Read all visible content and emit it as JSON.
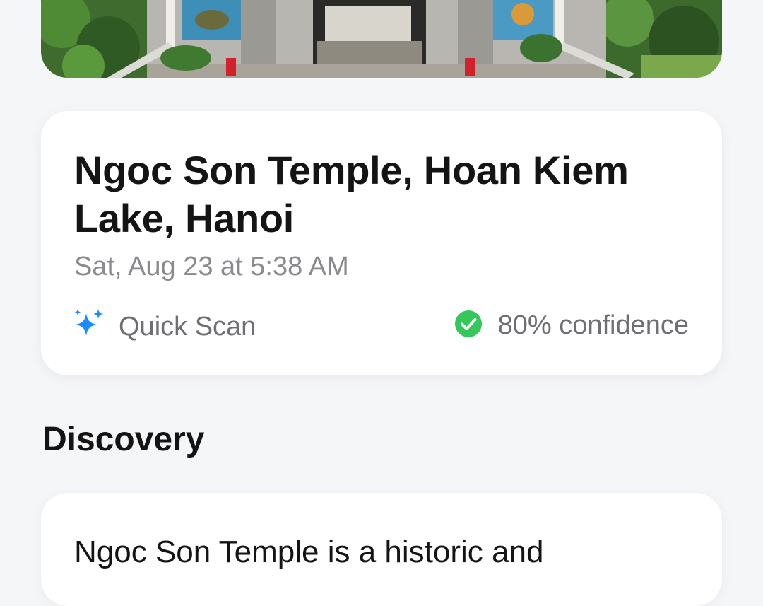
{
  "place": {
    "title": "Ngoc Son Temple, Hoan Kiem Lake, Hanoi",
    "date": "Sat, Aug 23 at 5:38 AM",
    "scan_type": "Quick Scan",
    "confidence": "80% confidence"
  },
  "colors": {
    "accent": "#1a8cff",
    "success": "#34c759"
  },
  "icons": {
    "scan": "sparkles-icon",
    "confidence": "checkmark-circle-icon"
  },
  "discovery": {
    "heading": "Discovery",
    "text": "Ngoc Son Temple is a historic and"
  }
}
